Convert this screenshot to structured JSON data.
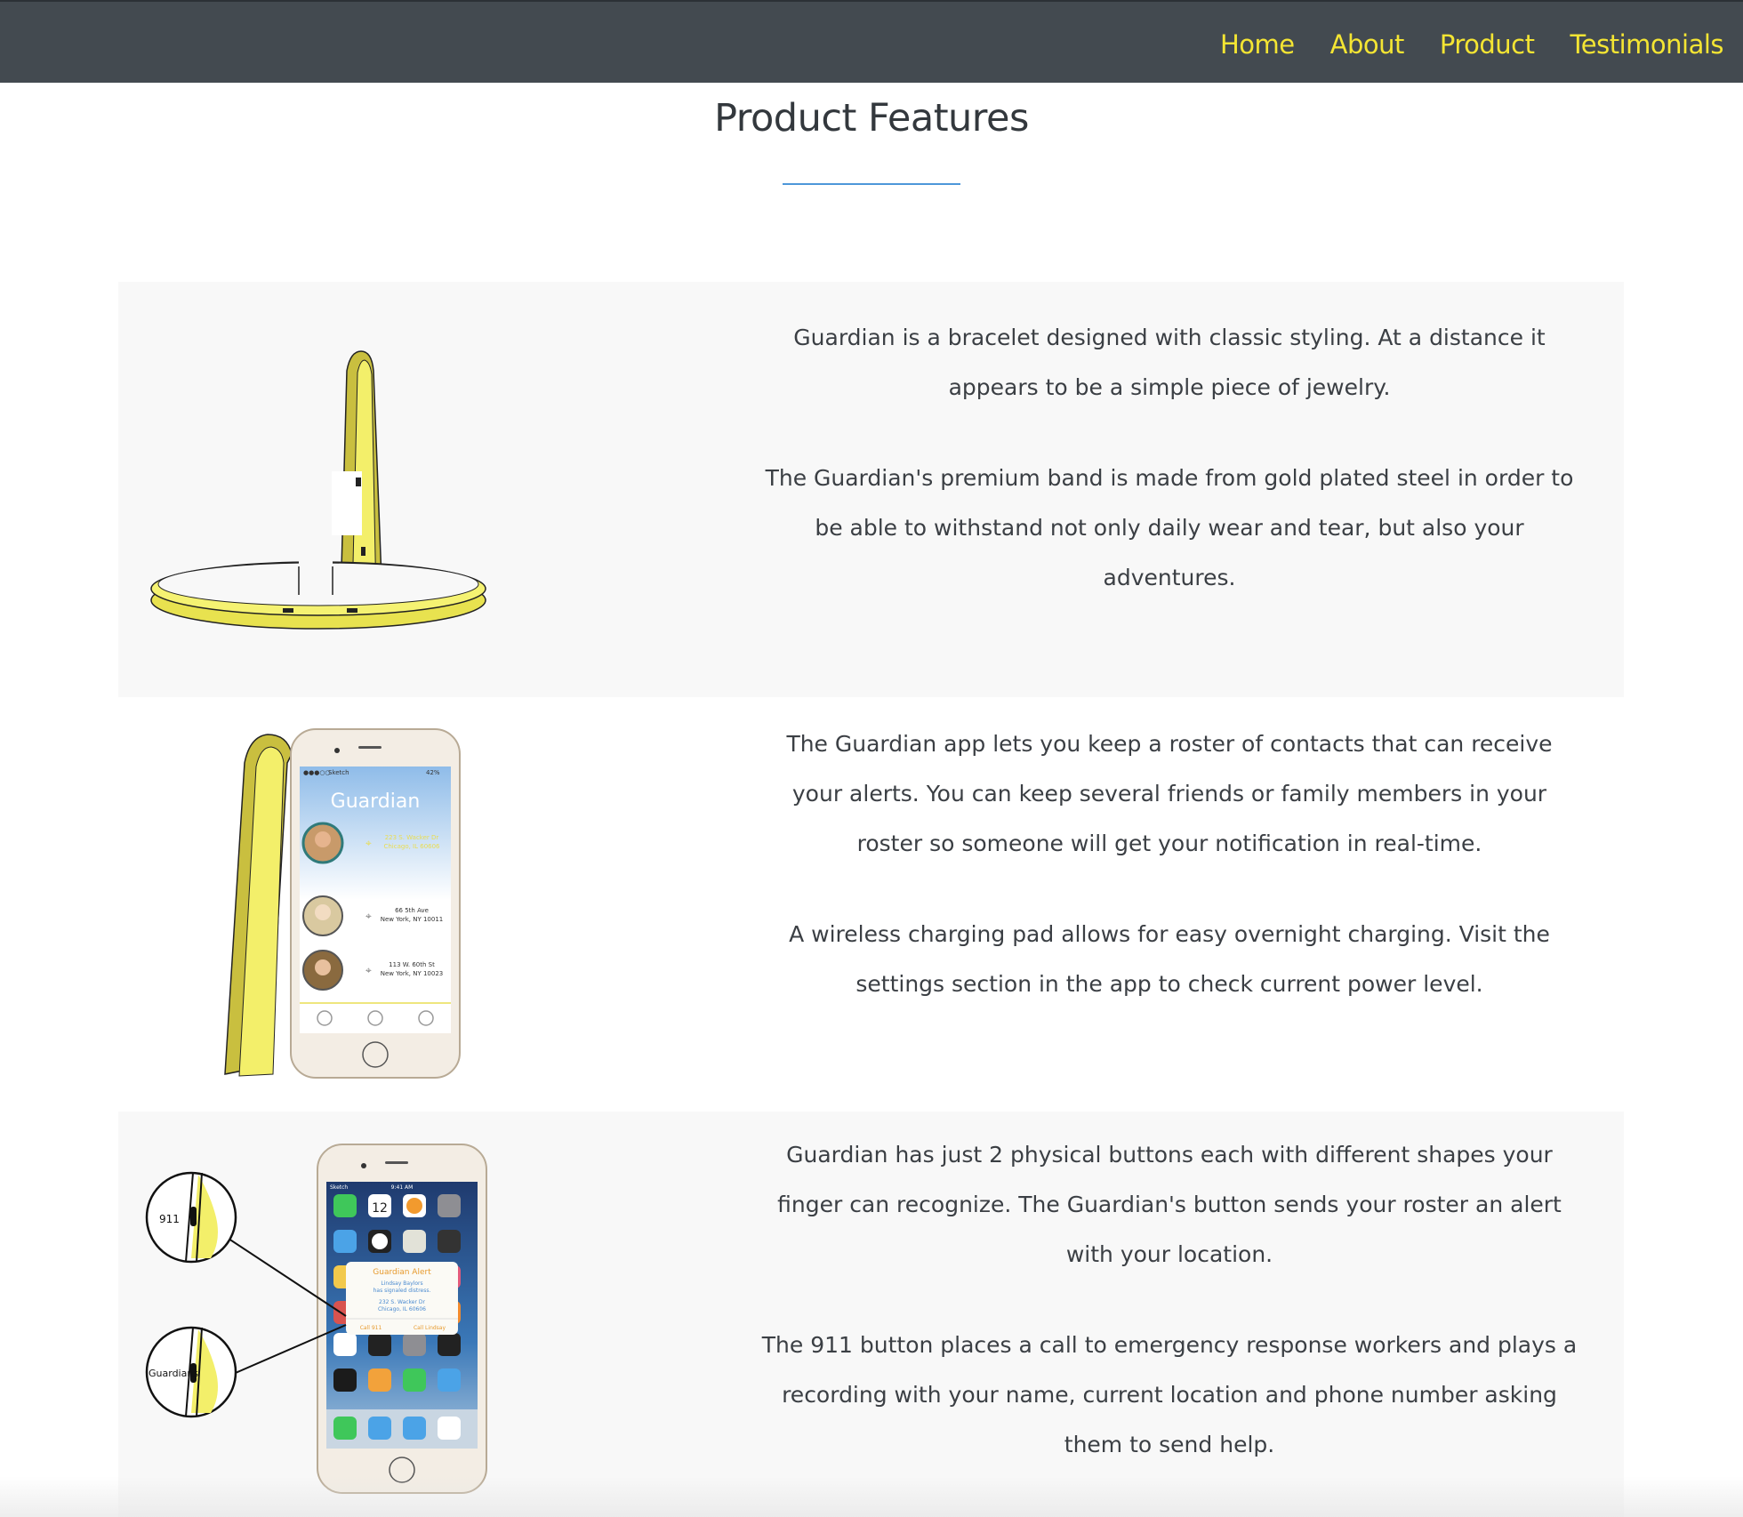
{
  "nav": {
    "items": [
      {
        "label": "Home"
      },
      {
        "label": "About"
      },
      {
        "label": "Product"
      },
      {
        "label": "Testimonials"
      }
    ]
  },
  "page": {
    "title": "Product Features"
  },
  "features": [
    {
      "paragraphs": [
        "Guardian is a bracelet designed with classic styling. At a distance it appears to be a simple piece of jewelry.",
        "The Guardian's premium band is made from gold plated steel in order to be able to withstand not only daily wear and tear, but also your adventures."
      ]
    },
    {
      "paragraphs": [
        "The Guardian app lets you keep a roster of contacts that can receive your alerts. You can keep several friends or family members in your roster so someone will get your notification in real-time.",
        "A wireless charging pad allows for easy overnight charging. Visit the settings section in the app to check current power level."
      ],
      "phone": {
        "status": "Sketch",
        "battery": "42%",
        "app_title": "Guardian",
        "contacts": [
          {
            "line1": "223 S. Wacker Dr",
            "line2": "Chicago, IL 60606"
          },
          {
            "line1": "66 5th Ave",
            "line2": "New York, NY 10011"
          },
          {
            "line1": "113 W. 60th St",
            "line2": "New York, NY 10023"
          }
        ]
      }
    },
    {
      "paragraphs": [
        "Guardian has just 2 physical buttons each with different shapes your finger can recognize. The Guardian's button sends your roster an alert with your location.",
        "The 911 button places a call to emergency response workers and plays a recording with your name, current location and phone number asking them to send help."
      ],
      "callouts": {
        "top": "911",
        "bottom": "Guardians"
      },
      "phone": {
        "status": "Sketch",
        "time": "9:41 AM",
        "calendar_day": "12",
        "alert": {
          "title": "Guardian Alert",
          "line1": "Lindsay Baylors",
          "line2": "has signaled distress.",
          "line3": "232 S. Wacker Dr",
          "line4": "Chicago, IL 60606",
          "action_left": "Call 911",
          "action_right": "Call Lindsay"
        }
      }
    }
  ],
  "colors": {
    "nav_bg": "#434a50",
    "nav_link": "#f4e533",
    "accent_rule": "#4d97d9",
    "band_gold": "#f1ee60"
  }
}
